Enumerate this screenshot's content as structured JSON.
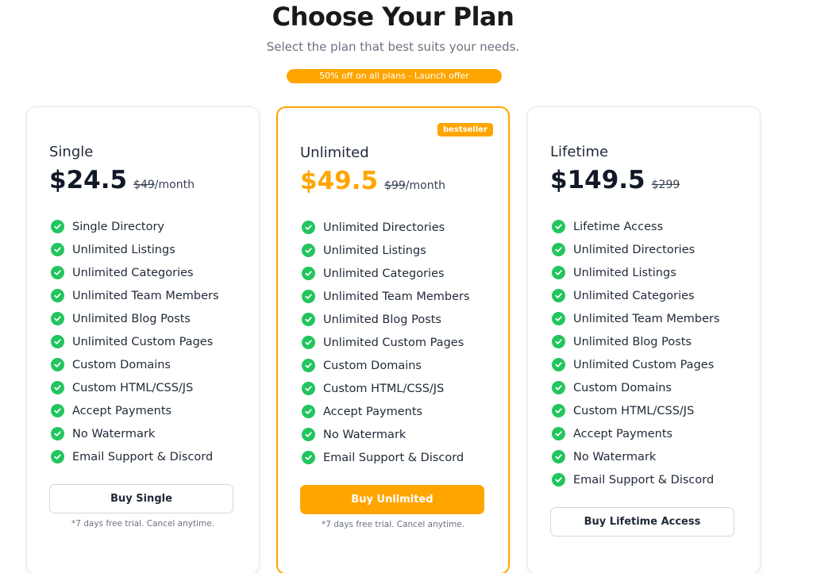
{
  "header": {
    "title": "Choose Your Plan",
    "subtitle": "Select the plan that best suits your needs.",
    "offer": "50% off on all plans - Launch offer"
  },
  "colors": {
    "accent": "#ffa500",
    "check": "#22c55e"
  },
  "icons": {
    "feature_check": "check-circle-icon"
  },
  "plans": [
    {
      "name": "Single",
      "price": "$24.5",
      "old_price": "$49",
      "period": "/month",
      "features": [
        "Single Directory",
        "Unlimited Listings",
        "Unlimited Categories",
        "Unlimited Team Members",
        "Unlimited Blog Posts",
        "Unlimited Custom Pages",
        "Custom Domains",
        "Custom HTML/CSS/JS",
        "Accept Payments",
        "No Watermark",
        "Email Support & Discord"
      ],
      "button": "Buy Single",
      "note": "*7 days free trial. Cancel anytime."
    },
    {
      "name": "Unlimited",
      "badge": "bestseller",
      "price": "$49.5",
      "old_price": "$99",
      "period": "/month",
      "features": [
        "Unlimited Directories",
        "Unlimited Listings",
        "Unlimited Categories",
        "Unlimited Team Members",
        "Unlimited Blog Posts",
        "Unlimited Custom Pages",
        "Custom Domains",
        "Custom HTML/CSS/JS",
        "Accept Payments",
        "No Watermark",
        "Email Support & Discord"
      ],
      "button": "Buy Unlimited",
      "note": "*7 days free trial. Cancel anytime."
    },
    {
      "name": "Lifetime",
      "price": "$149.5",
      "old_price": "$299",
      "features": [
        "Lifetime Access",
        "Unlimited Directories",
        "Unlimited Listings",
        "Unlimited Categories",
        "Unlimited Team Members",
        "Unlimited Blog Posts",
        "Unlimited Custom Pages",
        "Custom Domains",
        "Custom HTML/CSS/JS",
        "Accept Payments",
        "No Watermark",
        "Email Support & Discord"
      ],
      "button": "Buy Lifetime Access"
    }
  ]
}
